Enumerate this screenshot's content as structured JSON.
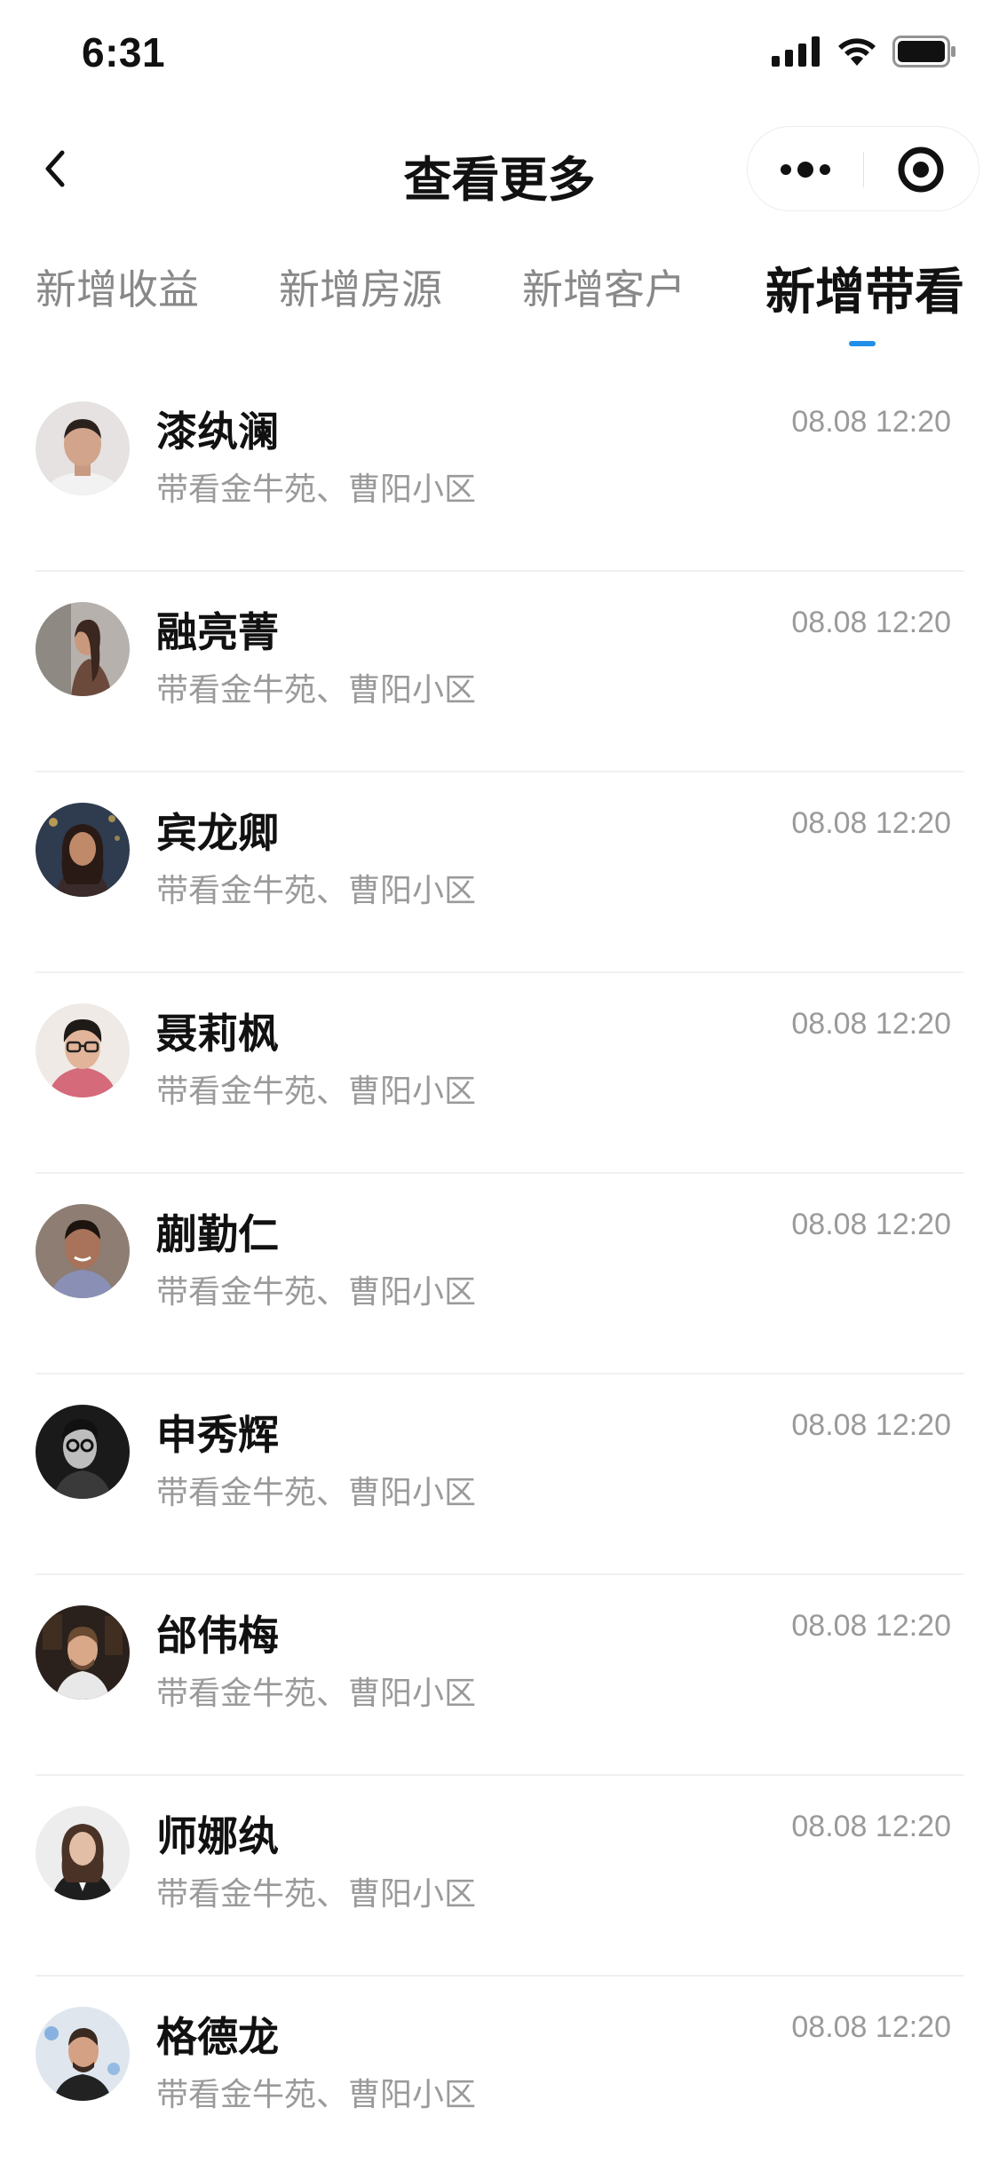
{
  "status_bar": {
    "time": "6:31"
  },
  "nav": {
    "title": "查看更多"
  },
  "tabs": [
    {
      "label": "新增收益",
      "active": false
    },
    {
      "label": "新增房源",
      "active": false
    },
    {
      "label": "新增客户",
      "active": false
    },
    {
      "label": "新增带看",
      "active": true
    }
  ],
  "colors": {
    "accent": "#1f8fe8",
    "secondary_text": "#9a9a9a",
    "primary_text": "#111111"
  },
  "items": [
    {
      "name": "漆纨澜",
      "desc": "带看金牛苑、曹阳小区",
      "time": "08.08 12:20"
    },
    {
      "name": "融亮菁",
      "desc": "带看金牛苑、曹阳小区",
      "time": "08.08 12:20"
    },
    {
      "name": "宾龙卿",
      "desc": "带看金牛苑、曹阳小区",
      "time": "08.08 12:20"
    },
    {
      "name": "聂莉枫",
      "desc": "带看金牛苑、曹阳小区",
      "time": "08.08 12:20"
    },
    {
      "name": "蒯勤仁",
      "desc": "带看金牛苑、曹阳小区",
      "time": "08.08 12:20"
    },
    {
      "name": "申秀辉",
      "desc": "带看金牛苑、曹阳小区",
      "time": "08.08 12:20"
    },
    {
      "name": "邰伟梅",
      "desc": "带看金牛苑、曹阳小区",
      "time": "08.08 12:20"
    },
    {
      "name": "师娜纨",
      "desc": "带看金牛苑、曹阳小区",
      "time": "08.08 12:20"
    },
    {
      "name": "格德龙",
      "desc": "带看金牛苑、曹阳小区",
      "time": "08.08 12:20"
    }
  ]
}
